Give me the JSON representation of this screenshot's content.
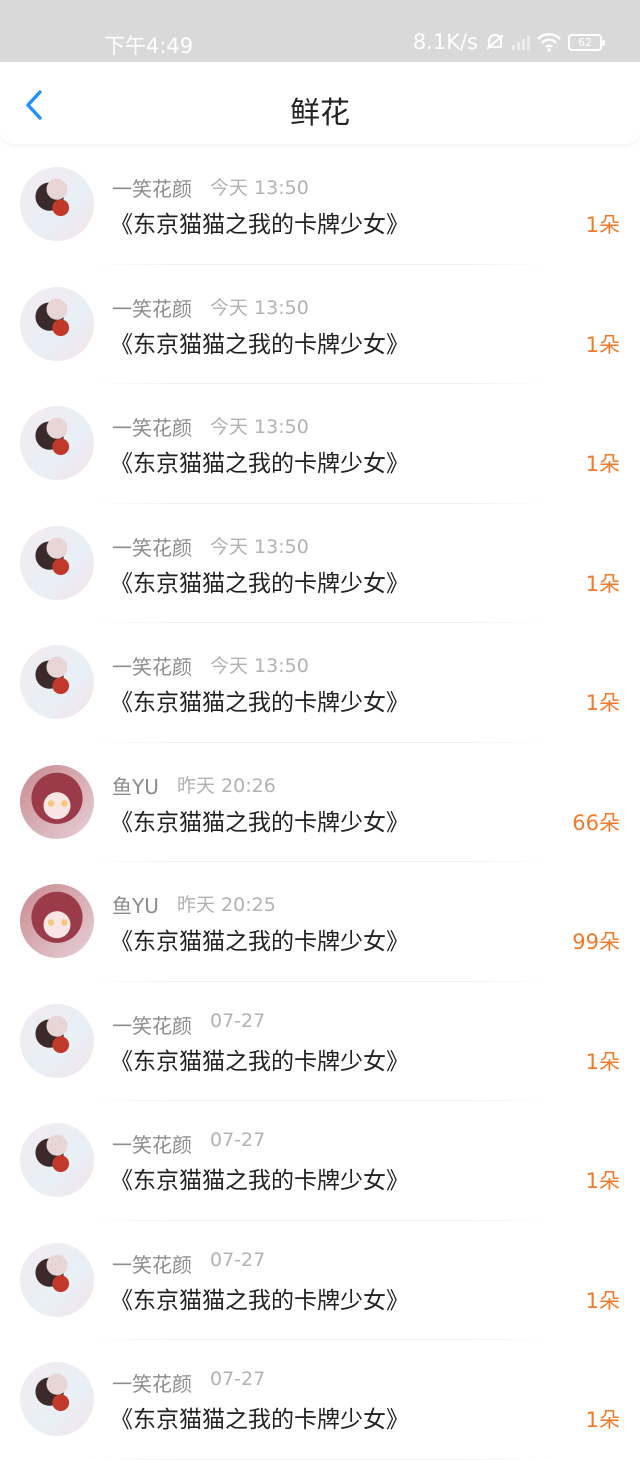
{
  "status_bar": {
    "time": "下午4:49",
    "network_speed": "8.1K/s",
    "battery": "62",
    "icons": [
      "bell-muted-icon",
      "signal-icon",
      "wifi-icon",
      "battery-icon"
    ]
  },
  "navbar": {
    "title": "鲜花",
    "back_icon": "chevron-left-icon",
    "accent_color": "#1e90ff"
  },
  "items": [
    {
      "avatar": "a1",
      "name": "一笑花颜",
      "time": "今天 13:50",
      "work": "《东京猫猫之我的卡牌少女》",
      "count": "1朵"
    },
    {
      "avatar": "a1",
      "name": "一笑花颜",
      "time": "今天 13:50",
      "work": "《东京猫猫之我的卡牌少女》",
      "count": "1朵"
    },
    {
      "avatar": "a1",
      "name": "一笑花颜",
      "time": "今天 13:50",
      "work": "《东京猫猫之我的卡牌少女》",
      "count": "1朵"
    },
    {
      "avatar": "a1",
      "name": "一笑花颜",
      "time": "今天 13:50",
      "work": "《东京猫猫之我的卡牌少女》",
      "count": "1朵"
    },
    {
      "avatar": "a1",
      "name": "一笑花颜",
      "time": "今天 13:50",
      "work": "《东京猫猫之我的卡牌少女》",
      "count": "1朵"
    },
    {
      "avatar": "a2",
      "name": "鱼YU",
      "time": "昨天 20:26",
      "work": "《东京猫猫之我的卡牌少女》",
      "count": "66朵"
    },
    {
      "avatar": "a2",
      "name": "鱼YU",
      "time": "昨天 20:25",
      "work": "《东京猫猫之我的卡牌少女》",
      "count": "99朵"
    },
    {
      "avatar": "a1",
      "name": "一笑花颜",
      "time": "07-27",
      "work": "《东京猫猫之我的卡牌少女》",
      "count": "1朵"
    },
    {
      "avatar": "a1",
      "name": "一笑花颜",
      "time": "07-27",
      "work": "《东京猫猫之我的卡牌少女》",
      "count": "1朵"
    },
    {
      "avatar": "a1",
      "name": "一笑花颜",
      "time": "07-27",
      "work": "《东京猫猫之我的卡牌少女》",
      "count": "1朵"
    },
    {
      "avatar": "a1",
      "name": "一笑花颜",
      "time": "07-27",
      "work": "《东京猫猫之我的卡牌少女》",
      "count": "1朵"
    }
  ],
  "colors": {
    "count": "#f07a2a",
    "status_bar_bg": "#d9d9d9"
  }
}
